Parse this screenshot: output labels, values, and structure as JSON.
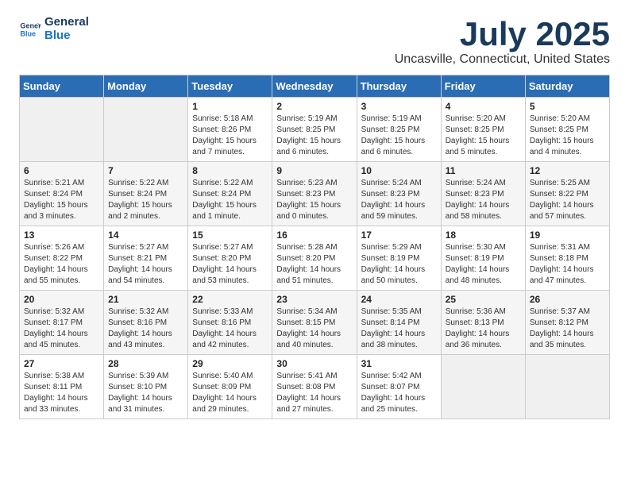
{
  "logo": {
    "text_general": "General",
    "text_blue": "Blue"
  },
  "title": "July 2025",
  "subtitle": "Uncasville, Connecticut, United States",
  "days_of_week": [
    "Sunday",
    "Monday",
    "Tuesday",
    "Wednesday",
    "Thursday",
    "Friday",
    "Saturday"
  ],
  "weeks": [
    [
      {
        "day": "",
        "info": ""
      },
      {
        "day": "",
        "info": ""
      },
      {
        "day": "1",
        "info": "Sunrise: 5:18 AM\nSunset: 8:26 PM\nDaylight: 15 hours and 7 minutes."
      },
      {
        "day": "2",
        "info": "Sunrise: 5:19 AM\nSunset: 8:25 PM\nDaylight: 15 hours and 6 minutes."
      },
      {
        "day": "3",
        "info": "Sunrise: 5:19 AM\nSunset: 8:25 PM\nDaylight: 15 hours and 6 minutes."
      },
      {
        "day": "4",
        "info": "Sunrise: 5:20 AM\nSunset: 8:25 PM\nDaylight: 15 hours and 5 minutes."
      },
      {
        "day": "5",
        "info": "Sunrise: 5:20 AM\nSunset: 8:25 PM\nDaylight: 15 hours and 4 minutes."
      }
    ],
    [
      {
        "day": "6",
        "info": "Sunrise: 5:21 AM\nSunset: 8:24 PM\nDaylight: 15 hours and 3 minutes."
      },
      {
        "day": "7",
        "info": "Sunrise: 5:22 AM\nSunset: 8:24 PM\nDaylight: 15 hours and 2 minutes."
      },
      {
        "day": "8",
        "info": "Sunrise: 5:22 AM\nSunset: 8:24 PM\nDaylight: 15 hours and 1 minute."
      },
      {
        "day": "9",
        "info": "Sunrise: 5:23 AM\nSunset: 8:23 PM\nDaylight: 15 hours and 0 minutes."
      },
      {
        "day": "10",
        "info": "Sunrise: 5:24 AM\nSunset: 8:23 PM\nDaylight: 14 hours and 59 minutes."
      },
      {
        "day": "11",
        "info": "Sunrise: 5:24 AM\nSunset: 8:23 PM\nDaylight: 14 hours and 58 minutes."
      },
      {
        "day": "12",
        "info": "Sunrise: 5:25 AM\nSunset: 8:22 PM\nDaylight: 14 hours and 57 minutes."
      }
    ],
    [
      {
        "day": "13",
        "info": "Sunrise: 5:26 AM\nSunset: 8:22 PM\nDaylight: 14 hours and 55 minutes."
      },
      {
        "day": "14",
        "info": "Sunrise: 5:27 AM\nSunset: 8:21 PM\nDaylight: 14 hours and 54 minutes."
      },
      {
        "day": "15",
        "info": "Sunrise: 5:27 AM\nSunset: 8:20 PM\nDaylight: 14 hours and 53 minutes."
      },
      {
        "day": "16",
        "info": "Sunrise: 5:28 AM\nSunset: 8:20 PM\nDaylight: 14 hours and 51 minutes."
      },
      {
        "day": "17",
        "info": "Sunrise: 5:29 AM\nSunset: 8:19 PM\nDaylight: 14 hours and 50 minutes."
      },
      {
        "day": "18",
        "info": "Sunrise: 5:30 AM\nSunset: 8:19 PM\nDaylight: 14 hours and 48 minutes."
      },
      {
        "day": "19",
        "info": "Sunrise: 5:31 AM\nSunset: 8:18 PM\nDaylight: 14 hours and 47 minutes."
      }
    ],
    [
      {
        "day": "20",
        "info": "Sunrise: 5:32 AM\nSunset: 8:17 PM\nDaylight: 14 hours and 45 minutes."
      },
      {
        "day": "21",
        "info": "Sunrise: 5:32 AM\nSunset: 8:16 PM\nDaylight: 14 hours and 43 minutes."
      },
      {
        "day": "22",
        "info": "Sunrise: 5:33 AM\nSunset: 8:16 PM\nDaylight: 14 hours and 42 minutes."
      },
      {
        "day": "23",
        "info": "Sunrise: 5:34 AM\nSunset: 8:15 PM\nDaylight: 14 hours and 40 minutes."
      },
      {
        "day": "24",
        "info": "Sunrise: 5:35 AM\nSunset: 8:14 PM\nDaylight: 14 hours and 38 minutes."
      },
      {
        "day": "25",
        "info": "Sunrise: 5:36 AM\nSunset: 8:13 PM\nDaylight: 14 hours and 36 minutes."
      },
      {
        "day": "26",
        "info": "Sunrise: 5:37 AM\nSunset: 8:12 PM\nDaylight: 14 hours and 35 minutes."
      }
    ],
    [
      {
        "day": "27",
        "info": "Sunrise: 5:38 AM\nSunset: 8:11 PM\nDaylight: 14 hours and 33 minutes."
      },
      {
        "day": "28",
        "info": "Sunrise: 5:39 AM\nSunset: 8:10 PM\nDaylight: 14 hours and 31 minutes."
      },
      {
        "day": "29",
        "info": "Sunrise: 5:40 AM\nSunset: 8:09 PM\nDaylight: 14 hours and 29 minutes."
      },
      {
        "day": "30",
        "info": "Sunrise: 5:41 AM\nSunset: 8:08 PM\nDaylight: 14 hours and 27 minutes."
      },
      {
        "day": "31",
        "info": "Sunrise: 5:42 AM\nSunset: 8:07 PM\nDaylight: 14 hours and 25 minutes."
      },
      {
        "day": "",
        "info": ""
      },
      {
        "day": "",
        "info": ""
      }
    ]
  ]
}
